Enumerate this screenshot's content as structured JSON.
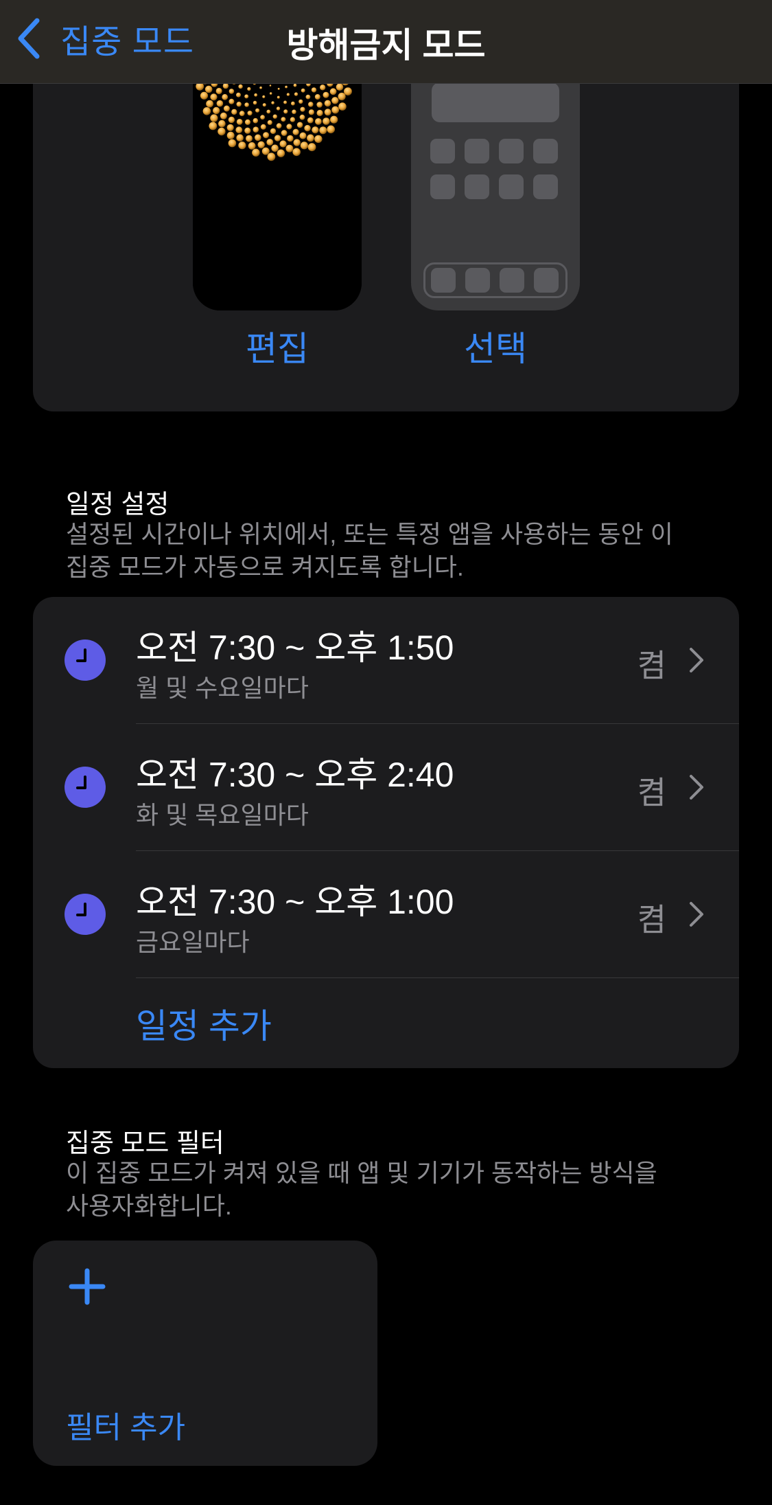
{
  "nav": {
    "back_label": "집중 모드",
    "title": "방해금지 모드"
  },
  "customize": {
    "lock_label": "편집",
    "home_label": "선택"
  },
  "schedule": {
    "header": "일정 설정",
    "desc_line1": "설정된 시간이나 위치에서, 또는 특정 앱을 사용하는 동안 이",
    "desc_line2": "집중 모드가 자동으로 켜지도록 합니다.",
    "items": [
      {
        "time": "오전 7:30 ~ 오후 1:50",
        "days": "월 및 수요일마다",
        "status": "켬"
      },
      {
        "time": "오전 7:30 ~ 오후 2:40",
        "days": "화 및 목요일마다",
        "status": "켬"
      },
      {
        "time": "오전 7:30 ~ 오후 1:00",
        "days": "금요일마다",
        "status": "켬"
      }
    ],
    "add_label": "일정 추가"
  },
  "filters": {
    "header": "집중 모드 필터",
    "desc_line1": "이 집중 모드가 켜져 있을 때 앱 및 기기가 동작하는 방식을",
    "desc_line2": "사용자화합니다.",
    "add_label": "필터 추가"
  },
  "colors": {
    "accent": "#3a88f5",
    "clock": "#5e5ce6",
    "card": "#1c1c1e"
  }
}
